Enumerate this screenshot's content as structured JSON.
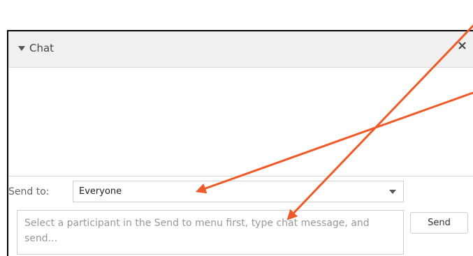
{
  "chat_panel": {
    "title": "Chat",
    "collapse_icon": "triangle-down-icon",
    "close_icon": "close-x-icon",
    "close_symbol": "×",
    "send_to_label": "Send to:",
    "recipient": {
      "selected": "Everyone",
      "arrow_icon": "triangle-down-icon"
    },
    "message_input": {
      "placeholder": "Select a participant in the Send to menu first, type chat message, and send..."
    },
    "send_button_label": "Send"
  },
  "colors": {
    "header_background": "#f0f0f0",
    "annotation_arrow": "#f05a28",
    "panel_border": "#000000",
    "placeholder_text": "#999999",
    "field_border": "#cfcfcf"
  }
}
